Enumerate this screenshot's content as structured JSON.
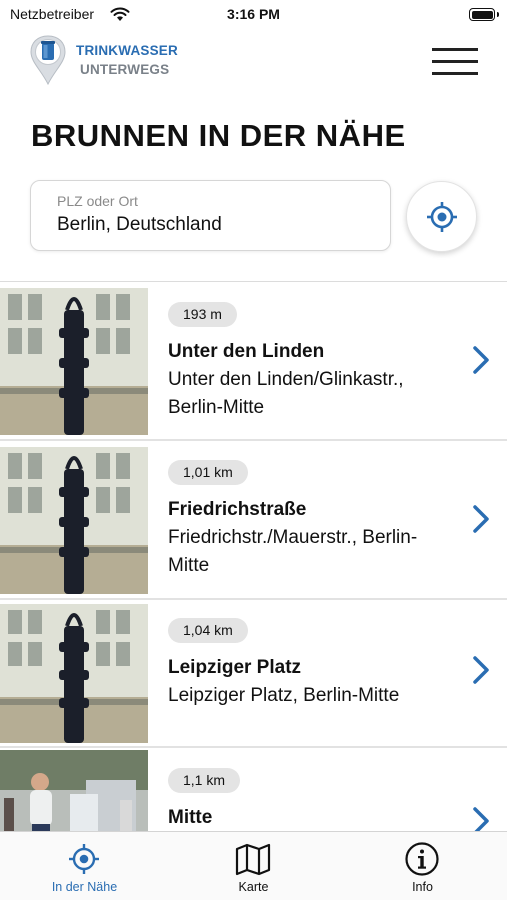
{
  "status_bar": {
    "carrier": "Netzbetreiber",
    "time": "3:16 PM",
    "icons": [
      "wifi-icon",
      "battery-icon"
    ]
  },
  "header": {
    "brand_line1": "TRINKWASSER",
    "brand_line2": "UNTERWEGS",
    "logo_icon": "water-fountain-pin-icon",
    "menu_icon": "hamburger-menu-icon"
  },
  "page_title": "BRUNNEN IN DER NÄHE",
  "search": {
    "placeholder": "PLZ oder Ort",
    "value": "Berlin, Deutschland",
    "locate_icon": "location-target-icon"
  },
  "fountains": [
    {
      "distance": "193 m",
      "name": "Unter den Linden",
      "address_lines": [
        "Unter den Linden/Glinkastr.,",
        "Berlin-Mitte"
      ],
      "image": "water-pump-photo"
    },
    {
      "distance": "1,01 km",
      "name": "Friedrichstraße",
      "address_lines": [
        "Friedrichstr./Mauerstr., Berlin-",
        "Mitte"
      ],
      "image": "water-pump-photo"
    },
    {
      "distance": "1,04 km",
      "name": "Leipziger Platz",
      "address_lines": [
        "Leipziger Platz, Berlin-Mitte"
      ],
      "image": "water-pump-photo"
    },
    {
      "distance": "1,1 km",
      "name": "Mitte",
      "address_lines": [],
      "image": "street-scene-photo"
    }
  ],
  "tabs": [
    {
      "label": "In der Nähe",
      "icon": "location-target-icon",
      "active": true
    },
    {
      "label": "Karte",
      "icon": "map-icon",
      "active": false
    },
    {
      "label": "Info",
      "icon": "info-icon",
      "active": false
    }
  ],
  "colors": {
    "accent": "#2a6db2",
    "text": "#111111",
    "secondary_text": "#7a8189",
    "badge_bg": "#e4e4e4"
  }
}
